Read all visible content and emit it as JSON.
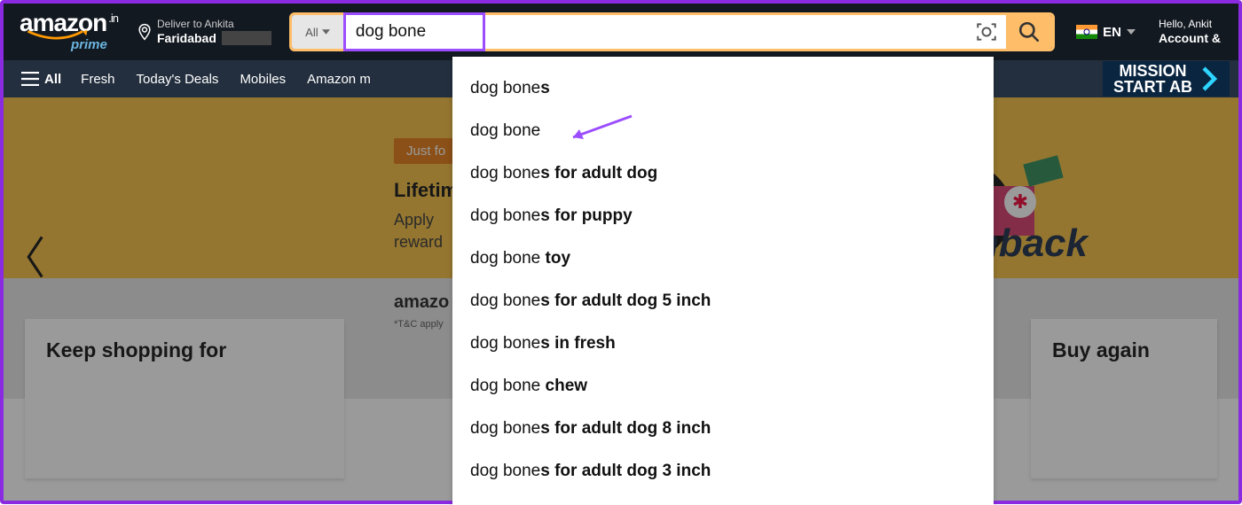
{
  "logo": {
    "brand": "amazon",
    "tld": ".in",
    "sub": "prime"
  },
  "deliver": {
    "line1": "Deliver to Ankita",
    "line2": "Faridabad"
  },
  "search": {
    "category": "All",
    "query": "dog bone"
  },
  "lang": {
    "code": "EN"
  },
  "account": {
    "greet": "Hello, Ankit",
    "label": "Account &"
  },
  "subnav": {
    "all": "All",
    "items": [
      "Fresh",
      "Today's Deals",
      "Mobiles",
      "Amazon m"
    ],
    "mission_l1": "MISSION",
    "mission_l2": "START AB"
  },
  "hero": {
    "pill": "Just fo",
    "headline": "Lifetim",
    "subline": "Apply\nreward",
    "pay": "amazo",
    "tnc": "*T&C apply",
    "cashback_suffix": "shback"
  },
  "cards": {
    "left_title": "Keep shopping for",
    "right_title": "Buy again"
  },
  "suggestions": [
    {
      "pre": "dog bone",
      "bold": "s"
    },
    {
      "pre": "dog bone",
      "bold": ""
    },
    {
      "pre": "dog bone",
      "bold": "s for adult dog"
    },
    {
      "pre": "dog bone",
      "bold": "s for puppy"
    },
    {
      "pre": "dog bone ",
      "bold": "toy"
    },
    {
      "pre": "dog bone",
      "bold": "s for adult dog 5 inch"
    },
    {
      "pre": "dog bone",
      "bold": "s in fresh"
    },
    {
      "pre": "dog bone ",
      "bold": "chew"
    },
    {
      "pre": "dog bone",
      "bold": "s for adult dog 8 inch"
    },
    {
      "pre": "dog bone",
      "bold": "s for adult dog 3 inch"
    }
  ]
}
